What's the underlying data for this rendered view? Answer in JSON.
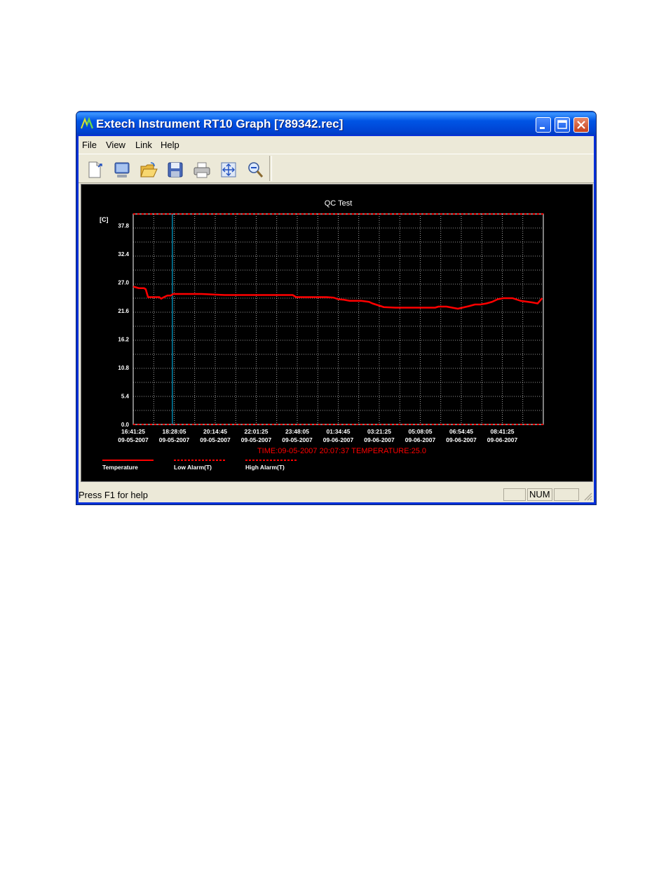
{
  "window": {
    "title": "Extech Instrument RT10 Graph [789342.rec]"
  },
  "menu": {
    "items": [
      "File",
      "View",
      "Link",
      "Help"
    ]
  },
  "toolbar": {
    "buttons": [
      "new-icon",
      "monitor-icon",
      "open-folder-icon",
      "save-icon",
      "print-icon",
      "fit-icon",
      "zoom-out-icon"
    ]
  },
  "status": {
    "help_text": "Press F1 for help",
    "num_indicator": "NUM"
  },
  "colors": {
    "series": "#ff0000",
    "cursor": "#00c8ff",
    "background": "#000000",
    "grid": "#c8c8c8"
  },
  "chart_data": {
    "type": "line",
    "title": "QC Test",
    "ylabel": "[C]",
    "ylim": [
      0,
      40.0
    ],
    "y_ticks": [
      "37.8",
      "32.4",
      "27.0",
      "21.6",
      "16.2",
      "10.8",
      "5.4",
      "0.0"
    ],
    "y_tick_values": [
      37.8,
      32.4,
      27.0,
      21.6,
      16.2,
      10.8,
      5.4,
      0.0
    ],
    "x_ticks": [
      {
        "time": "16:41:25",
        "date": "09-05-2007"
      },
      {
        "time": "18:28:05",
        "date": "09-05-2007"
      },
      {
        "time": "20:14:45",
        "date": "09-05-2007"
      },
      {
        "time": "22:01:25",
        "date": "09-05-2007"
      },
      {
        "time": "23:48:05",
        "date": "09-05-2007"
      },
      {
        "time": "01:34:45",
        "date": "09-06-2007"
      },
      {
        "time": "03:21:25",
        "date": "09-06-2007"
      },
      {
        "time": "05:08:05",
        "date": "09-06-2007"
      },
      {
        "time": "06:54:45",
        "date": "09-06-2007"
      },
      {
        "time": "08:41:25",
        "date": "09-06-2007"
      }
    ],
    "grid": true,
    "cursor_readout": "TIME:09-05-2007 20:07:37    TEMPERATURE:25.0",
    "cursor_time_hours": 3.44,
    "series": [
      {
        "name": "Temperature",
        "style": "solid",
        "x_hours": [
          0,
          0.5,
          0.95,
          1.1,
          1.3,
          2.3,
          2.45,
          2.7,
          3.0,
          3.3,
          3.5,
          4.0,
          5.0,
          6.0,
          8.0,
          9.0,
          10.0,
          11.0,
          12.0,
          12.6,
          13.0,
          14.0,
          14.3,
          15.0,
          16.0,
          17.0,
          17.6,
          18.0,
          18.5,
          19.0,
          20.0,
          20.7,
          21.0,
          22.0,
          23.0,
          24.0,
          25.5,
          26.5,
          26.8,
          27.5,
          28.5,
          29.5,
          30.0,
          30.5,
          31.0,
          31.5,
          31.8,
          32.0,
          32.5,
          33.3,
          34.0,
          35.0,
          35.5,
          35.9
        ],
        "values": [
          26.2,
          25.9,
          25.9,
          25.7,
          24.2,
          24.2,
          23.9,
          24.2,
          24.5,
          24.5,
          24.8,
          24.8,
          24.8,
          24.8,
          24.6,
          24.6,
          24.6,
          24.6,
          24.6,
          24.6,
          24.6,
          24.6,
          24.2,
          24.2,
          24.2,
          24.2,
          24.1,
          23.8,
          23.7,
          23.5,
          23.5,
          23.3,
          23.0,
          22.3,
          22.2,
          22.2,
          22.2,
          22.2,
          22.4,
          22.4,
          22.0,
          22.5,
          22.8,
          22.8,
          23.0,
          23.3,
          23.6,
          23.8,
          24.0,
          24.0,
          23.5,
          23.2,
          23.0,
          24.0
        ]
      },
      {
        "name": "Low Alarm(T)",
        "style": "dashed",
        "value": 0.0
      },
      {
        "name": "High Alarm(T)",
        "style": "dashed",
        "value": 40.0
      }
    ]
  }
}
